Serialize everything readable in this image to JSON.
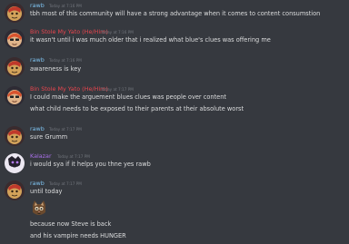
{
  "colors": {
    "background": "#36393f",
    "text": "#dcddde",
    "timestamp": "#72767d",
    "rawb": "#7ec2ef",
    "bin": "#e8454e",
    "kalazar": "#a970ea"
  },
  "messages": [
    {
      "author": "rawb",
      "timestamp": "Today at 7:16 PM",
      "lines": [
        "tbh most of this community will have a strong advantage when it comes to content consumstion"
      ]
    },
    {
      "author": "Bin Stole My Yato (He/Him)",
      "timestamp": "Today at 7:16 PM",
      "lines": [
        "it wasn't until i was much older that i realized what blue's clues was offering me"
      ]
    },
    {
      "author": "rawb",
      "timestamp": "Today at 7:16 PM",
      "lines": [
        "awareness is key"
      ]
    },
    {
      "author": "Bin Stole My Yato (He/Him)",
      "timestamp": "Today at 7:17 PM",
      "lines": [
        "I could make the arguement blues clues was people over content",
        "what child needs to be exposed to their parents at their absolute worst"
      ]
    },
    {
      "author": "rawb",
      "timestamp": "Today at 7:17 PM",
      "lines": [
        "sure Grumm"
      ]
    },
    {
      "author": "Kalazar",
      "timestamp": "Today at 7:17 PM",
      "lines": [
        "i would sya if it helps you thne yes rawb"
      ]
    },
    {
      "author": "rawb",
      "timestamp": "Today at 7:17 PM",
      "lines": [
        "until today",
        "because now Steve is back",
        "and his vampire needs HUNGER"
      ],
      "sticker_icon": "cat-emoji-icon"
    }
  ]
}
